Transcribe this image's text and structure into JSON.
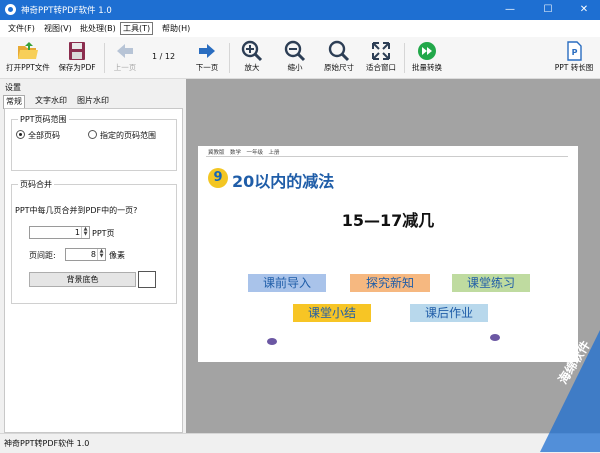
{
  "window": {
    "title": "神奇PPT转PDF软件 1.0",
    "min": "—",
    "max": "☐",
    "close": "✕"
  },
  "menu": [
    "文件(F)",
    "视图(V)",
    "批处理(B)",
    "工具(T)",
    "帮助(H)"
  ],
  "toolbar": {
    "open": "打开PPT文件",
    "save": "保存为PDF",
    "prev": "上一页",
    "page": "1 / 12",
    "next": "下一页",
    "zoom_in": "放大",
    "zoom_out": "缩小",
    "original": "原始尺寸",
    "fit": "适合窗口",
    "batch": "批量转换",
    "ppt_long": "PPT 转长图"
  },
  "panel": {
    "heading": "设置",
    "tabs": [
      "常规",
      "文字水印",
      "图片水印"
    ],
    "range_group": "PPT页码范围",
    "opt_all": "全部页码",
    "opt_range": "指定的页码范围",
    "merge_group": "页码合并",
    "merge_desc": "PPT中每几页合并到PDF中的一页?",
    "pages_value": "1",
    "pages_unit": "PPT页",
    "spacing_label": "页间距:",
    "spacing_value": "8",
    "spacing_unit": "像素",
    "bg_btn": "背景底色"
  },
  "slide": {
    "crumb": "冀教版　数学　一年级　上册",
    "num": "9",
    "title": "20以内的减法",
    "subtitle": "15—17减几",
    "chips": [
      "课前导入",
      "探究新知",
      "课堂练习",
      "课堂小结",
      "课后作业"
    ]
  },
  "status": "神奇PPT转PDF软件 1.0",
  "watermark": "海绵软件",
  "colors": {
    "titlebar": "#1e6fd2",
    "chip_blue": "#a9c3ea",
    "chip_orange": "#f6b880",
    "chip_green": "#bfdba0",
    "chip_yellow": "#f7c525",
    "chip_lblue": "#b8d8ec"
  }
}
